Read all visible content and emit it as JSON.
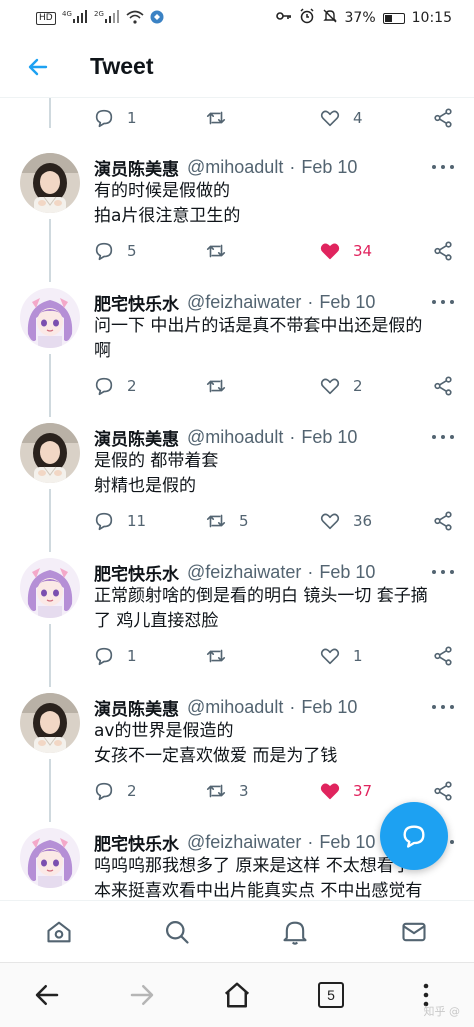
{
  "status_bar": {
    "network_badge": "HD",
    "signal_1": "4G",
    "signal_2": "2G",
    "battery": "37%",
    "time": "10:15"
  },
  "header": {
    "title": "Tweet"
  },
  "top_actions": {
    "replies": "1",
    "retweets": "",
    "likes": "4"
  },
  "tweets": [
    {
      "name": "演员陈美惠",
      "handle": "@mihoadult",
      "dot": "·",
      "date": "Feb 10",
      "lines": [
        "有的时候是假做的",
        "拍a片很注意卫生的"
      ],
      "replies": "5",
      "retweets": "",
      "likes": "34",
      "liked": true,
      "avatar": "woman-avatar"
    },
    {
      "name": "肥宅快乐水",
      "handle": "@feizhaiwater",
      "dot": "·",
      "date": "Feb 10",
      "lines": [
        "问一下 中出片的话是真不带套中出还是假的",
        "啊"
      ],
      "replies": "2",
      "retweets": "",
      "likes": "2",
      "liked": false,
      "avatar": "anime-girl-avatar"
    },
    {
      "name": "演员陈美惠",
      "handle": "@mihoadult",
      "dot": "·",
      "date": "Feb 10",
      "lines": [
        "是假的 都带着套",
        "射精也是假的"
      ],
      "replies": "11",
      "retweets": "5",
      "likes": "36",
      "liked": false,
      "avatar": "woman-avatar"
    },
    {
      "name": "肥宅快乐水",
      "handle": "@feizhaiwater",
      "dot": "·",
      "date": "Feb 10",
      "lines": [
        "正常颜射啥的倒是看的明白 镜头一切 套子摘",
        "了 鸡儿直接怼脸"
      ],
      "replies": "1",
      "retweets": "",
      "likes": "1",
      "liked": false,
      "avatar": "anime-girl-avatar"
    },
    {
      "name": "演员陈美惠",
      "handle": "@mihoadult",
      "dot": "·",
      "date": "Feb 10",
      "lines": [
        "av的世界是假造的",
        "女孩不一定喜欢做爱 而是为了钱"
      ],
      "replies": "2",
      "retweets": "3",
      "likes": "37",
      "liked": true,
      "avatar": "woman-avatar"
    },
    {
      "name": "肥宅快乐水",
      "handle": "@feizhaiwater",
      "dot": "·",
      "date": "Feb 10",
      "lines": [
        "呜呜呜那我想多了 原来是这样 不太想看了",
        "本来挺喜欢看中出片能真实点 不中出感觉有"
      ],
      "replies": "",
      "retweets": "",
      "likes": "",
      "liked": false,
      "avatar": "anime-girl-avatar"
    }
  ],
  "tab_bar": [
    "home-icon",
    "search-icon",
    "notifications-icon",
    "messages-icon"
  ],
  "browser_bar": {
    "tab_count": "5",
    "watermark": "知乎 @"
  },
  "colors": {
    "accent": "#1da1f2",
    "like": "#e0245e",
    "muted": "#536471",
    "thread": "#cfd9de"
  }
}
